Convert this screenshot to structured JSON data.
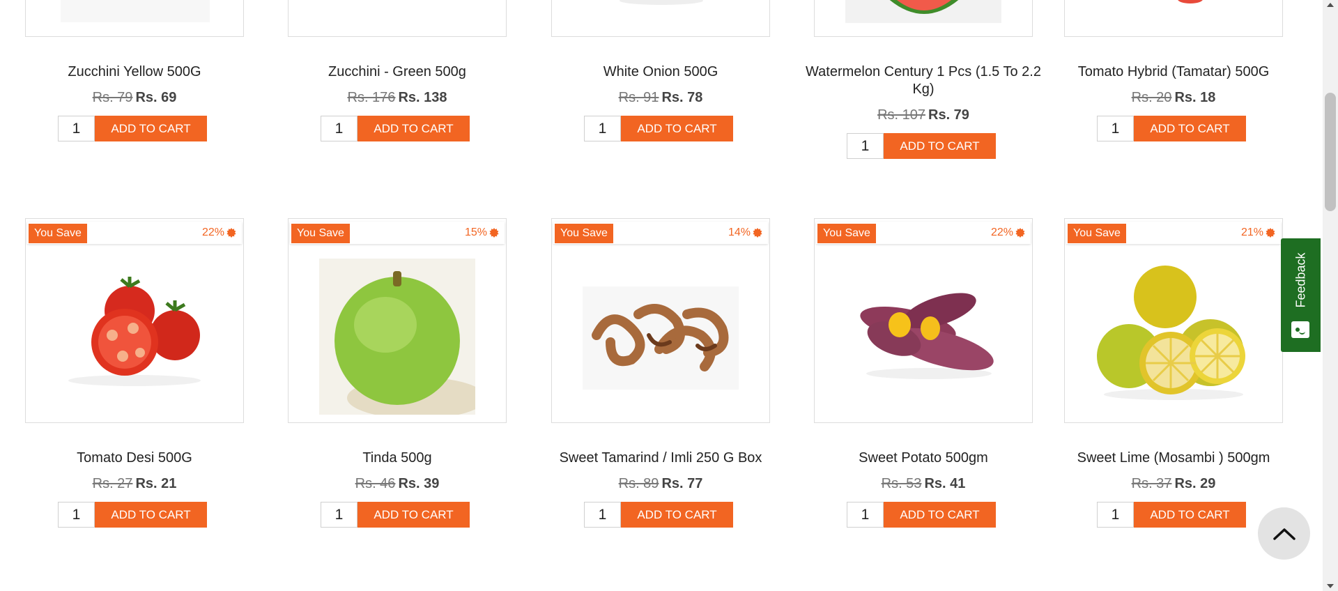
{
  "theme": {
    "accent": "#f26522",
    "feedback_green": "#1e6e22"
  },
  "row1": [
    {
      "name": "Zucchini Yellow 500G",
      "old_price": "Rs. 79",
      "new_price": "Rs. 69",
      "qty": "1",
      "cta": "ADD TO CART"
    },
    {
      "name": "Zucchini - Green 500g",
      "old_price": "Rs. 176",
      "new_price": "Rs. 138",
      "qty": "1",
      "cta": "ADD TO CART"
    },
    {
      "name": "White Onion 500G",
      "old_price": "Rs. 91",
      "new_price": "Rs. 78",
      "qty": "1",
      "cta": "ADD TO CART"
    },
    {
      "name": "Watermelon Century 1 Pcs (1.5 To 2.2 Kg)",
      "old_price": "Rs. 107",
      "new_price": "Rs. 79",
      "qty": "1",
      "cta": "ADD TO CART"
    },
    {
      "name": "Tomato Hybrid (Tamatar) 500G",
      "old_price": "Rs. 20",
      "new_price": "Rs. 18",
      "qty": "1",
      "cta": "ADD TO CART"
    }
  ],
  "row2": [
    {
      "name": "Tomato Desi 500G",
      "old_price": "Rs. 27",
      "new_price": "Rs. 21",
      "qty": "1",
      "cta": "ADD TO CART",
      "badge": "You Save",
      "save_pct": "22%",
      "image": "tomato-image"
    },
    {
      "name": "Tinda 500g",
      "old_price": "Rs. 46",
      "new_price": "Rs. 39",
      "qty": "1",
      "cta": "ADD TO CART",
      "badge": "You Save",
      "save_pct": "15%",
      "image": "tinda-image"
    },
    {
      "name": "Sweet Tamarind / Imli 250 G Box",
      "old_price": "Rs. 89",
      "new_price": "Rs. 77",
      "qty": "1",
      "cta": "ADD TO CART",
      "badge": "You Save",
      "save_pct": "14%",
      "image": "tamarind-image"
    },
    {
      "name": "Sweet Potato 500gm",
      "old_price": "Rs. 53",
      "new_price": "Rs. 41",
      "qty": "1",
      "cta": "ADD TO CART",
      "badge": "You Save",
      "save_pct": "22%",
      "image": "sweet-potato-image"
    },
    {
      "name": "Sweet Lime (Mosambi ) 500gm",
      "old_price": "Rs. 37",
      "new_price": "Rs. 29",
      "qty": "1",
      "cta": "ADD TO CART",
      "badge": "You Save",
      "save_pct": "21%",
      "image": "sweet-lime-image"
    }
  ],
  "feedback": {
    "label": "Feedback",
    "icon": "smiley-chat-icon"
  },
  "scroll_top": {
    "icon": "chevron-up-icon"
  }
}
